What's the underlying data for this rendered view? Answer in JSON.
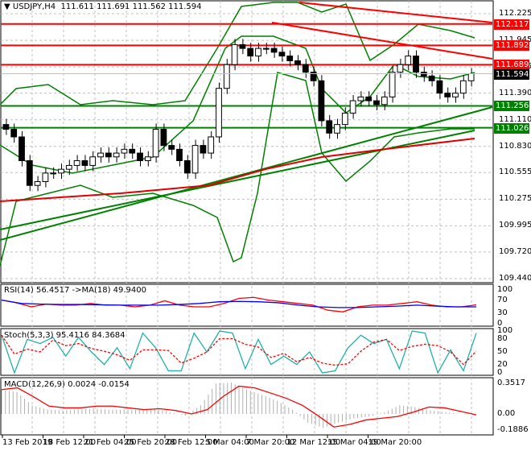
{
  "header": {
    "symbol": "USDJPY,H4",
    "ohlc": "111.611 111.691 111.562 111.594"
  },
  "price_tags": [
    {
      "value": "112.117",
      "color": "#ff0000"
    },
    {
      "value": "111.892",
      "color": "#ff0000"
    },
    {
      "value": "111.689",
      "color": "#ff0000"
    },
    {
      "value": "111.594",
      "color": "#000000"
    },
    {
      "value": "111.256",
      "color": "#008000"
    },
    {
      "value": "111.026",
      "color": "#008000"
    }
  ],
  "indicators": {
    "rsi_label": "RSI(14) 56.4517  ->MA(18) 49.9400",
    "stoch_label": "Stoch(5,3,3) 95.4116 84.3684",
    "macd_label": "MACD(12,26,9) 0.0024 -0.0154"
  },
  "chart_data": [
    {
      "type": "candlestick",
      "title": "USDJPY,H4",
      "ylim": [
        109.44,
        112.225
      ],
      "y_ticks": [
        "112.225",
        "111.945",
        "111.665",
        "111.390",
        "111.110",
        "110.830",
        "110.555",
        "110.275",
        "109.995",
        "109.720",
        "109.440"
      ],
      "x_ticks": [
        "13 Feb 2019",
        "18 Feb 12:00",
        "21 Feb 04:00",
        "25 Feb 20:00",
        "28 Feb 12:00",
        "5 Mar 04:00",
        "7 Mar 20:00",
        "12 Mar 12:00",
        "15 Mar 04:00",
        "19 Mar 20:00"
      ],
      "close": [
        111.01,
        110.93,
        110.68,
        110.42,
        110.46,
        110.55,
        110.55,
        110.59,
        110.63,
        110.68,
        110.63,
        110.72,
        110.76,
        110.72,
        110.76,
        110.8,
        110.76,
        110.68,
        110.72,
        111.01,
        110.84,
        110.8,
        110.68,
        110.55,
        110.84,
        110.76,
        110.93,
        111.44,
        111.69,
        111.9,
        111.86,
        111.78,
        111.86,
        111.86,
        111.82,
        111.78,
        111.73,
        111.69,
        111.61,
        111.52,
        111.1,
        110.97,
        111.06,
        111.18,
        111.31,
        111.35,
        111.31,
        111.27,
        111.35,
        111.61,
        111.69,
        111.78,
        111.61,
        111.57,
        111.52,
        111.39,
        111.35,
        111.39,
        111.52,
        111.594
      ],
      "levels": [
        112.117,
        111.892,
        111.689,
        111.256,
        111.026
      ]
    },
    {
      "type": "line",
      "title": "RSI(14)",
      "ylim": [
        0,
        100
      ],
      "y_ticks": [
        "100",
        "70",
        "30",
        "0"
      ],
      "series": [
        {
          "name": "RSI",
          "color": "#ff0000",
          "values": [
            70,
            62,
            50,
            58,
            55,
            55,
            60,
            55,
            55,
            50,
            55,
            68,
            55,
            50,
            50,
            60,
            75,
            78,
            70,
            65,
            60,
            55,
            40,
            35,
            50,
            55,
            55,
            60,
            65,
            55,
            50,
            50,
            56
          ]
        },
        {
          "name": "MA",
          "color": "#0000ff",
          "values": [
            70,
            60,
            58,
            57,
            57,
            56,
            55,
            55,
            55,
            57,
            60,
            65,
            66,
            65,
            62,
            55,
            50,
            48,
            48,
            50,
            52,
            55,
            52,
            50,
            50
          ]
        }
      ]
    },
    {
      "type": "line",
      "title": "Stoch(5,3,3)",
      "ylim": [
        0,
        100
      ],
      "y_ticks": [
        "100",
        "80",
        "50",
        "20",
        "0"
      ],
      "series": [
        {
          "name": "main",
          "color": "#20b2aa",
          "values": [
            90,
            0,
            80,
            70,
            85,
            40,
            85,
            50,
            20,
            60,
            10,
            95,
            60,
            5,
            5,
            95,
            50,
            100,
            95,
            10,
            80,
            20,
            40,
            20,
            50,
            0,
            5,
            60,
            90,
            70,
            80,
            10,
            100,
            95,
            0,
            55,
            5,
            95
          ]
        }
      ]
    },
    {
      "type": "bar",
      "title": "MACD(12,26,9)",
      "ylim": [
        -0.1886,
        0.3517
      ],
      "y_ticks": [
        "0.3517",
        "0.00",
        "-0.1886"
      ],
      "histogram": [
        0.28,
        0.25,
        0.1,
        0.05,
        0.04,
        0.05,
        0.06,
        0.05,
        0.05,
        0.05,
        0.06,
        0.02,
        -0.02,
        0.1,
        0.35,
        0.36,
        0.28,
        0.22,
        0.15,
        0.05,
        -0.1,
        -0.16,
        -0.1,
        -0.05,
        -0.03,
        0.02,
        0.1,
        0.08,
        0.04,
        0.02,
        0.0
      ],
      "signal": [
        0.28,
        0.3,
        0.2,
        0.09,
        0.07,
        0.07,
        0.09,
        0.09,
        0.07,
        0.05,
        0.06,
        0.04,
        0.0,
        0.05,
        0.2,
        0.32,
        0.3,
        0.24,
        0.18,
        0.1,
        -0.02,
        -0.15,
        -0.12,
        -0.07,
        -0.05,
        -0.03,
        0.02,
        0.08,
        0.07,
        0.03,
        -0.01
      ]
    }
  ]
}
